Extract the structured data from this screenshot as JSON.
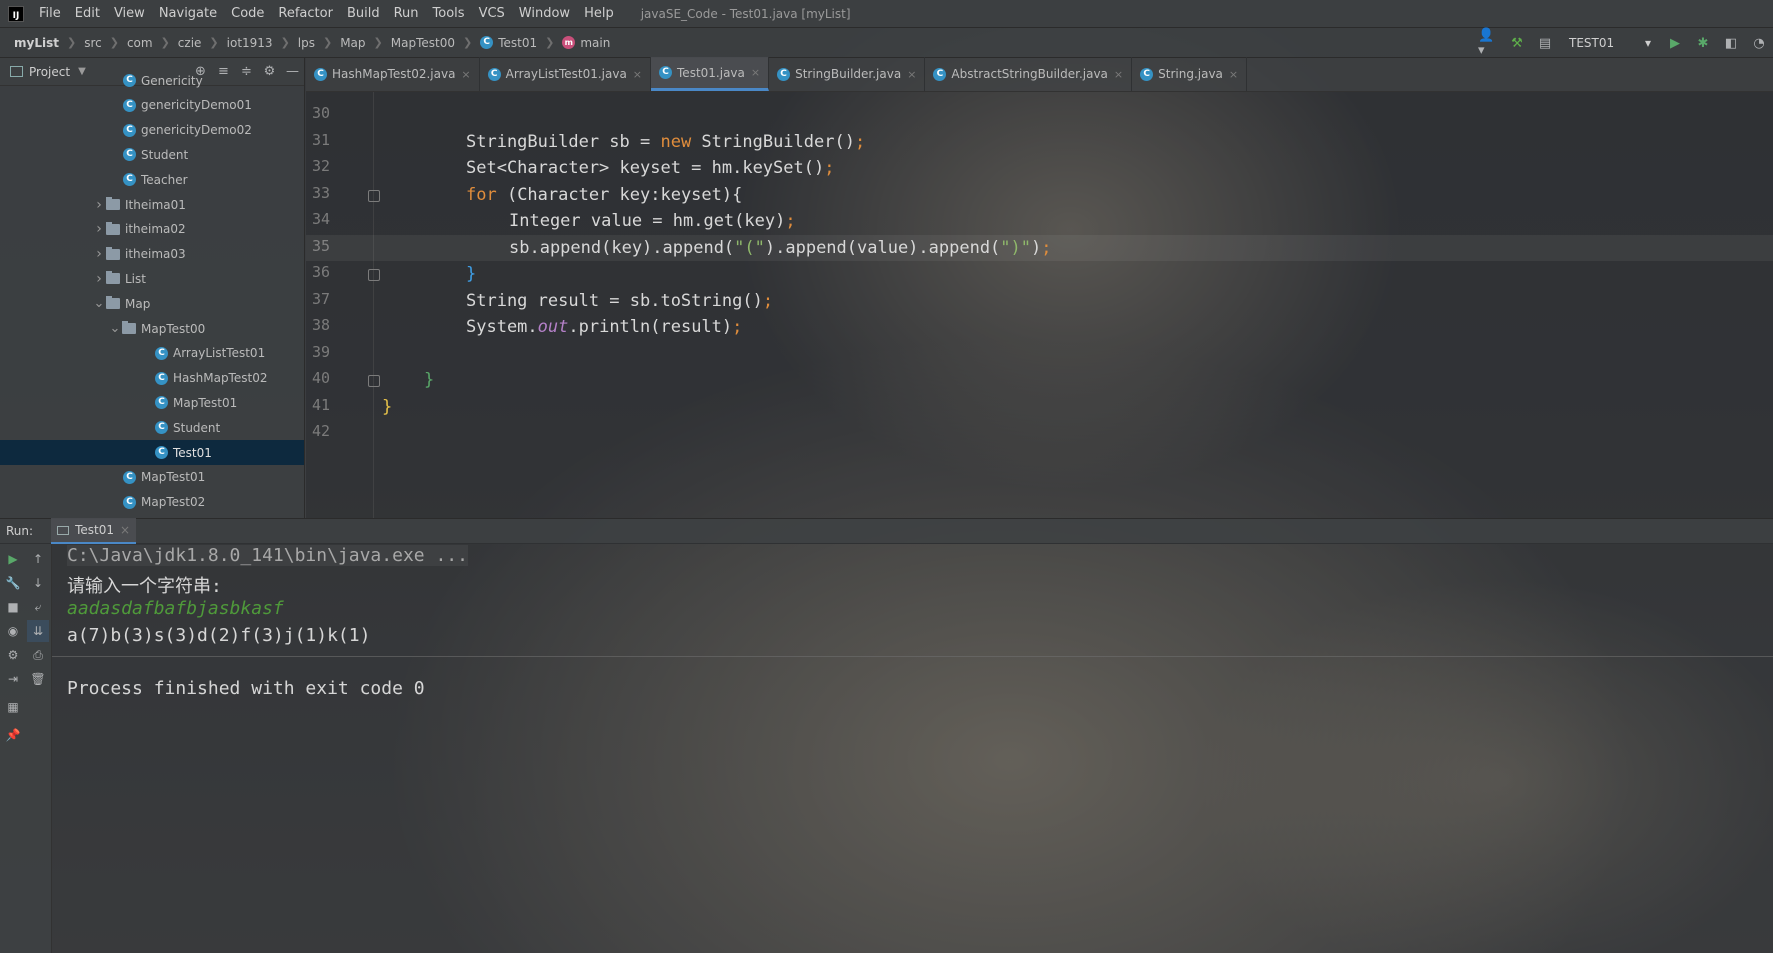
{
  "window": {
    "title": "javaSE_Code - Test01.java [myList]",
    "logo": "IJ"
  },
  "menu": [
    "File",
    "Edit",
    "View",
    "Navigate",
    "Code",
    "Refactor",
    "Build",
    "Run",
    "Tools",
    "VCS",
    "Window",
    "Help"
  ],
  "breadcrumb": [
    "myList",
    "src",
    "com",
    "czie",
    "iot1913",
    "lps",
    "Map",
    "MapTest00",
    "Test01",
    "main"
  ],
  "toolbar": {
    "run_config": "TEST01",
    "icons": [
      "user-icon",
      "hammer-icon",
      "layout-icon",
      "run-icon",
      "debug-icon",
      "coverage-icon",
      "profile-icon"
    ]
  },
  "project": {
    "title": "Project",
    "tree": [
      {
        "label": "Genericity",
        "kind": "class",
        "indent": 0
      },
      {
        "label": "genericityDemo01",
        "kind": "class",
        "indent": 0
      },
      {
        "label": "genericityDemo02",
        "kind": "class",
        "indent": 0
      },
      {
        "label": "Student",
        "kind": "class",
        "indent": 0
      },
      {
        "label": "Teacher",
        "kind": "class",
        "indent": 0
      },
      {
        "label": "Itheima01",
        "kind": "folder",
        "state": "collapsed",
        "indent": 0
      },
      {
        "label": "itheima02",
        "kind": "folder",
        "state": "collapsed",
        "indent": 0
      },
      {
        "label": "itheima03",
        "kind": "folder",
        "state": "collapsed",
        "indent": 0
      },
      {
        "label": "List",
        "kind": "folder",
        "state": "collapsed",
        "indent": 0
      },
      {
        "label": "Map",
        "kind": "folder",
        "state": "expanded",
        "indent": 0
      },
      {
        "label": "MapTest00",
        "kind": "folder",
        "state": "expanded",
        "indent": 1
      },
      {
        "label": "ArrayListTest01",
        "kind": "class",
        "indent": 2
      },
      {
        "label": "HashMapTest02",
        "kind": "class",
        "indent": 2
      },
      {
        "label": "MapTest01",
        "kind": "class",
        "indent": 2
      },
      {
        "label": "Student",
        "kind": "class",
        "indent": 2
      },
      {
        "label": "Test01",
        "kind": "class",
        "indent": 2,
        "selected": true
      },
      {
        "label": "MapTest01",
        "kind": "class",
        "indent": 0
      },
      {
        "label": "MapTest02",
        "kind": "class",
        "indent": 0
      }
    ]
  },
  "tabs": [
    {
      "label": "HashMapTest02.java",
      "active": false
    },
    {
      "label": "ArrayListTest01.java",
      "active": false
    },
    {
      "label": "Test01.java",
      "active": true
    },
    {
      "label": "StringBuilder.java",
      "active": false
    },
    {
      "label": "AbstractStringBuilder.java",
      "active": false
    },
    {
      "label": "String.java",
      "active": false
    }
  ],
  "editor": {
    "current_line": 35,
    "lines": [
      {
        "no": "30",
        "code": ""
      },
      {
        "no": "31",
        "code": "StringBuilder sb = new StringBuilder();"
      },
      {
        "no": "32",
        "code": "Set<Character> keyset = hm.keySet();"
      },
      {
        "no": "33",
        "code": "for (Character key:keyset){"
      },
      {
        "no": "34",
        "code": "Integer value = hm.get(key);"
      },
      {
        "no": "35",
        "code": "sb.append(key).append(\"(\").append(value).append(\")\");"
      },
      {
        "no": "36",
        "code": "}"
      },
      {
        "no": "37",
        "code": "String result = sb.toString();"
      },
      {
        "no": "38",
        "code": "System.out.println(result);"
      },
      {
        "no": "39",
        "code": ""
      },
      {
        "no": "40",
        "code": "}"
      },
      {
        "no": "41",
        "code": "}"
      },
      {
        "no": "42",
        "code": ""
      }
    ]
  },
  "run": {
    "label": "Run:",
    "tab": "Test01",
    "console": [
      {
        "text": "C:\\Java\\jdk1.8.0_141\\bin\\java.exe ...",
        "kind": "cmd"
      },
      {
        "text": "请输入一个字符串:",
        "kind": "output"
      },
      {
        "text": "aadasdafbafbjasbkasf",
        "kind": "input"
      },
      {
        "text": "a(7)b(3)s(3)d(2)f(3)j(1)k(1)",
        "kind": "output"
      },
      {
        "text": "Process finished with exit code 0",
        "kind": "output"
      }
    ]
  },
  "colors": {
    "keyword": "#e08d3c",
    "string": "#8fb86a",
    "selection": "#0d293e",
    "tab_accent": "#4a88c7",
    "console_input": "#4f9a3a"
  }
}
